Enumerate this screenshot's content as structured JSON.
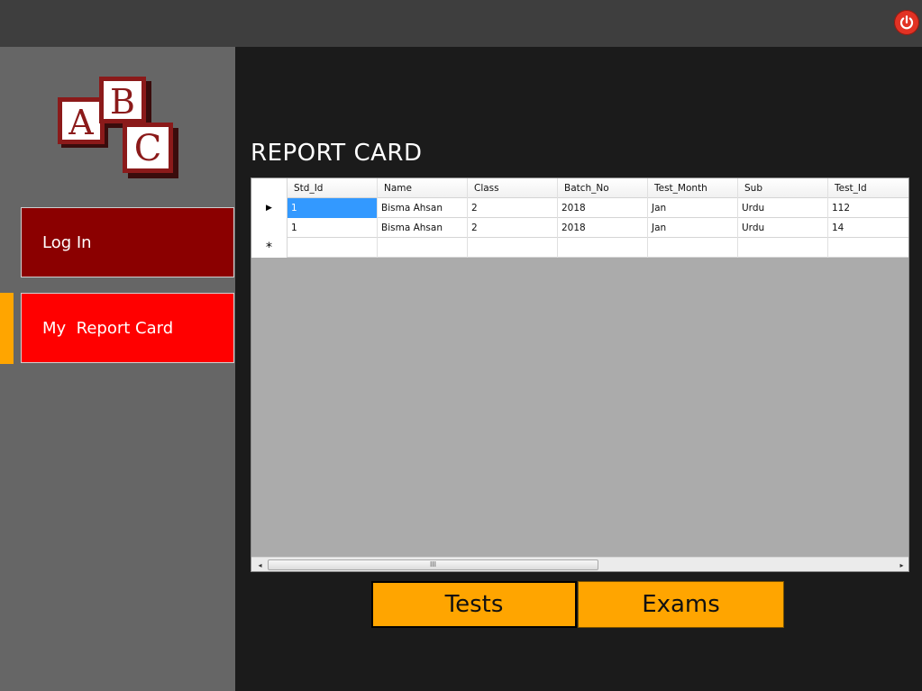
{
  "app": {
    "title": "REPORT CARD"
  },
  "logo": {
    "letters": [
      "A",
      "B",
      "C"
    ],
    "colors": {
      "block": "#8b1a1a",
      "face": "#ffffff"
    }
  },
  "sidebar": {
    "items": [
      {
        "label": "Log In",
        "color": "#8b0000"
      },
      {
        "label": "My  Report Card",
        "color": "#ff0000",
        "active": true
      }
    ],
    "active_marker_color": "#ffa500"
  },
  "grid": {
    "columns": [
      "Std_Id",
      "Name",
      "Class",
      "Batch_No",
      "Test_Month",
      "Sub",
      "Test_Id"
    ],
    "rows": [
      {
        "indicator": "▶",
        "cells": [
          "1",
          "Bisma Ahsan",
          "2",
          "2018",
          "Jan",
          "Urdu",
          "112"
        ]
      },
      {
        "indicator": "",
        "cells": [
          "1",
          "Bisma Ahsan",
          "2",
          "2018",
          "Jan",
          "Urdu",
          "14"
        ]
      }
    ],
    "new_row_indicator": "*",
    "scrollbar": {
      "left_arrow": "◂",
      "right_arrow": "▸",
      "thumb_grip": "III"
    }
  },
  "actions": {
    "tests_label": "Tests",
    "exams_label": "Exams",
    "color": "#ffa500"
  },
  "titlebar": {
    "power_icon": "power-icon",
    "power_color": "#e23224"
  }
}
